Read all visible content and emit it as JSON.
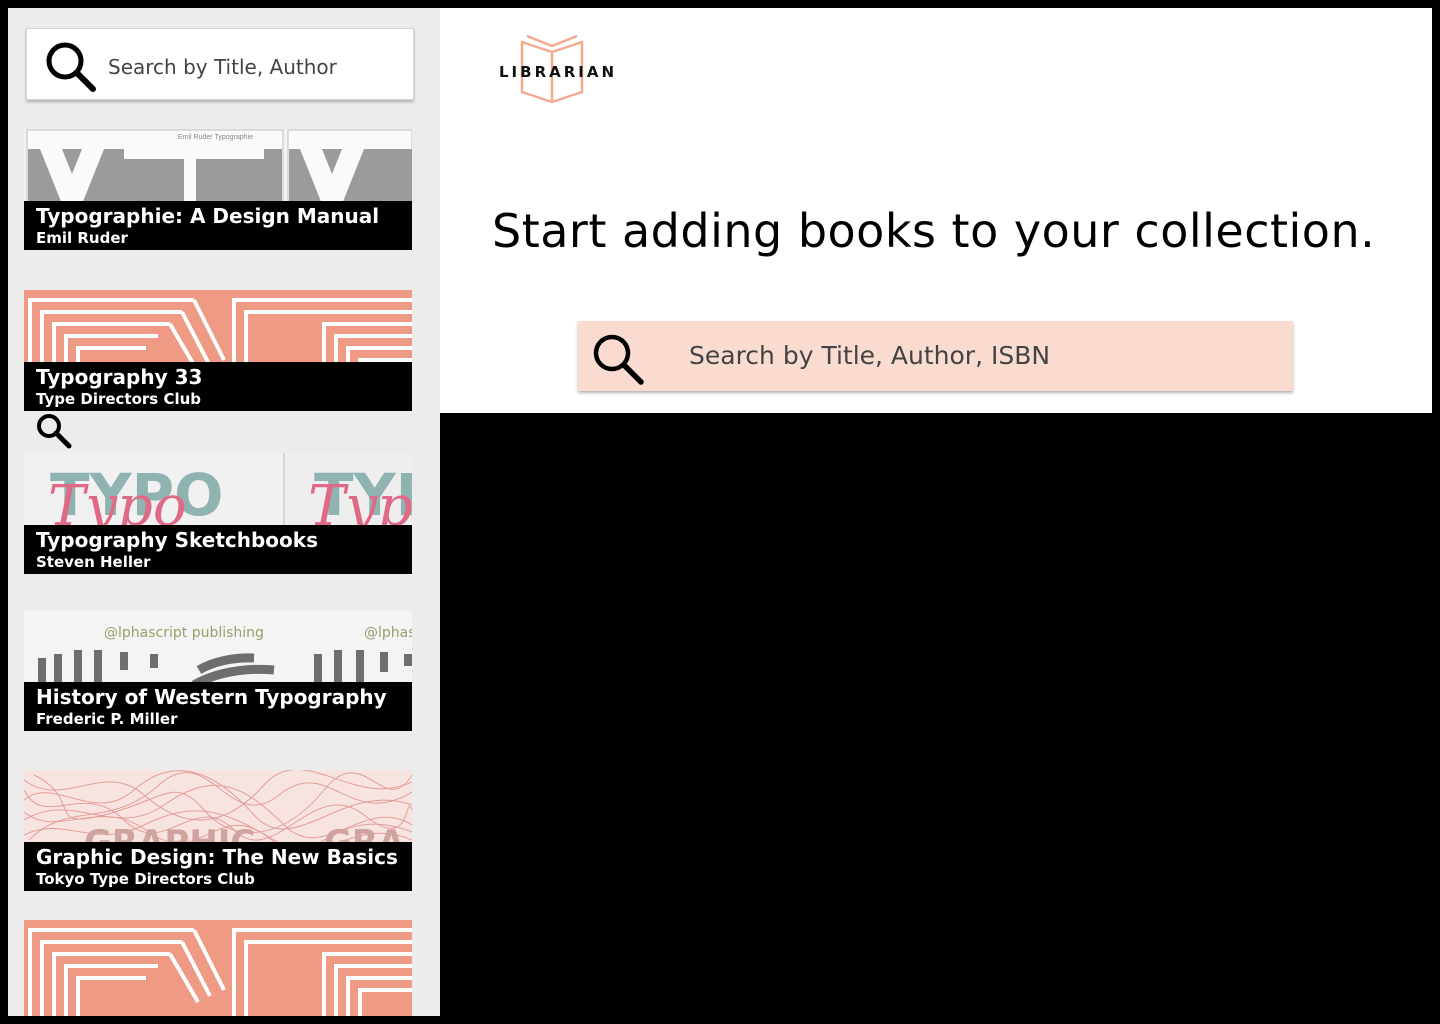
{
  "sidebar": {
    "search_placeholder": "Search by Title, Author",
    "books": [
      {
        "title": "Typographie: A Design Manual",
        "author": "Emil Ruder",
        "cover_style": "grey-letters",
        "cover_text": "Emil Ruder    Typographie"
      },
      {
        "title": "Typography 33",
        "author": "Type Directors Club",
        "cover_style": "salmon-stripes",
        "cover_text": ""
      },
      {
        "title": "Typography Sketchbooks",
        "author": "Steven Heller",
        "cover_style": "typo-script",
        "cover_text": ""
      },
      {
        "title": "History of Western Typography",
        "author": "Frederic P. Miller",
        "cover_style": "alphascript",
        "cover_text": "@lphascript publishing"
      },
      {
        "title": "Graphic Design: The New Basics",
        "author": "Tokyo Type Directors Club",
        "cover_style": "red-scribble",
        "cover_text": ""
      },
      {
        "title": "",
        "author": "",
        "cover_style": "salmon-stripes",
        "cover_text": ""
      }
    ]
  },
  "main": {
    "logo_text": "LIBRARIAN",
    "headline": "Start adding books to your collection.",
    "search_placeholder": "Search by Title, Author, ISBN"
  },
  "colors": {
    "accent_peach": "#f9dbd0",
    "logo_salmon": "#f4a98f",
    "stripe_salmon": "#ef9a85",
    "sidebar_bg": "#ececec"
  },
  "icons": {
    "search": "search-icon",
    "logo": "open-book-icon"
  }
}
